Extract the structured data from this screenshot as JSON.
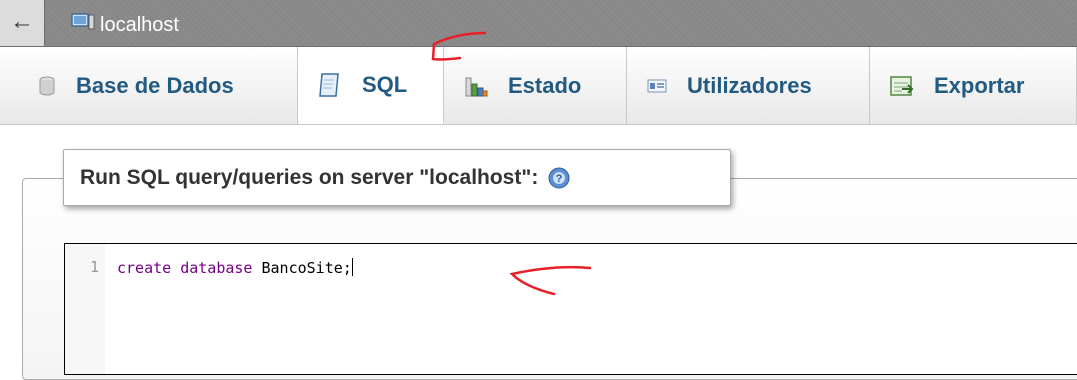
{
  "topbar": {
    "back_symbol": "←",
    "server_name": "localhost"
  },
  "tabs": [
    {
      "label": "Base de Dados",
      "icon": "database-icon",
      "active": false
    },
    {
      "label": "SQL",
      "icon": "sql-document-icon",
      "active": true
    },
    {
      "label": "Estado",
      "icon": "status-chart-icon",
      "active": false
    },
    {
      "label": "Utilizadores",
      "icon": "users-icon",
      "active": false
    },
    {
      "label": "Exportar",
      "icon": "export-icon",
      "active": false
    }
  ],
  "query_panel": {
    "legend": "Run SQL query/queries on server \"localhost\":",
    "help_icon": "help-icon"
  },
  "editor": {
    "line_number": "1",
    "keyword_1": "create",
    "keyword_2": "database",
    "identifier": "BancoSite;"
  },
  "colors": {
    "tab_text": "#235a81",
    "keyword": "#770088",
    "annotation": "#e8202a"
  }
}
